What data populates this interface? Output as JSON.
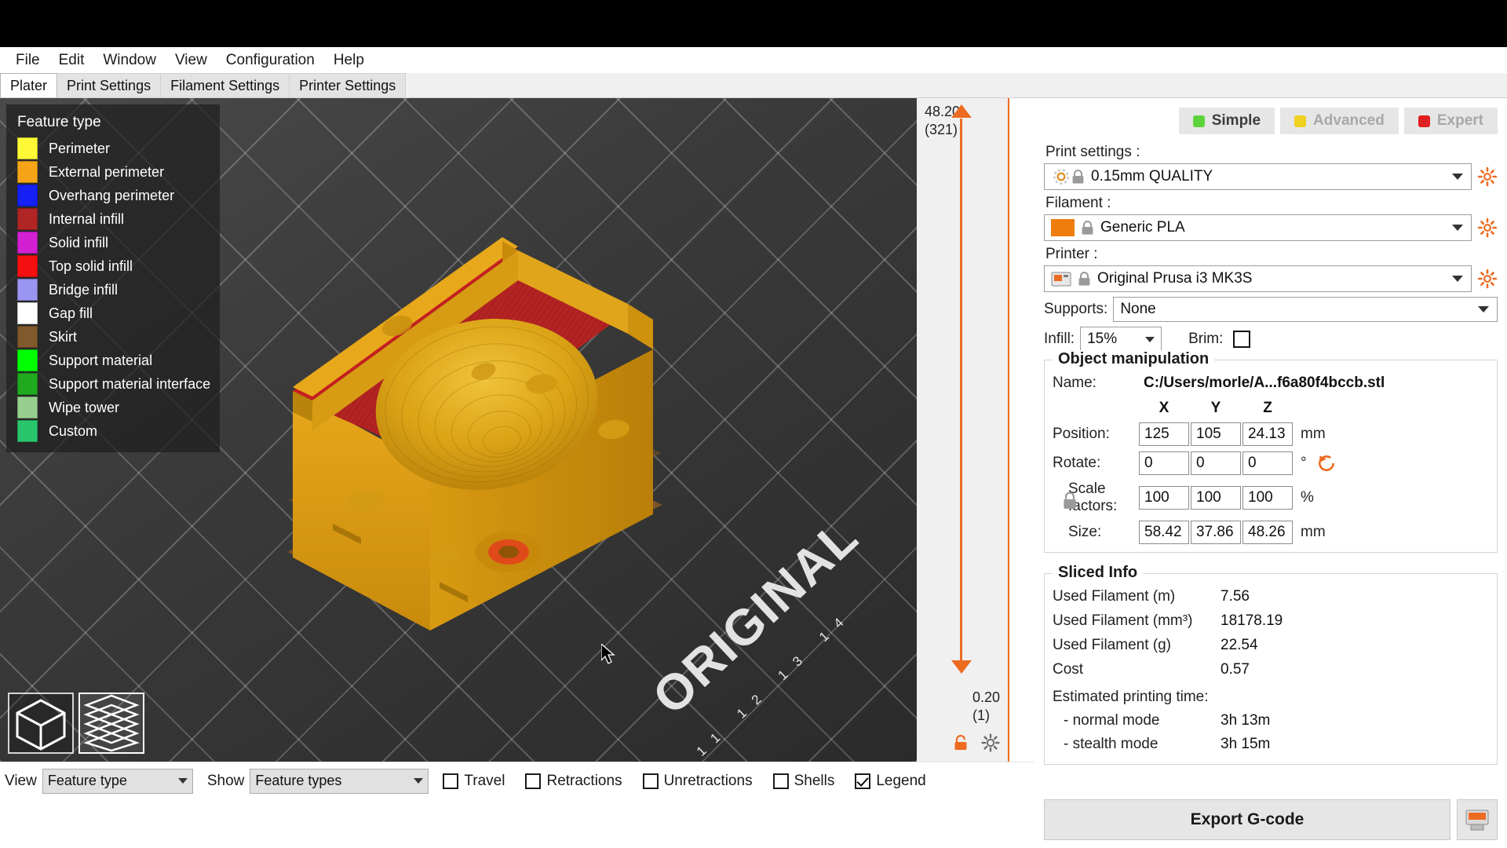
{
  "menu": {
    "items": [
      "File",
      "Edit",
      "Window",
      "View",
      "Configuration",
      "Help"
    ]
  },
  "tabs": [
    {
      "label": "Plater",
      "active": true
    },
    {
      "label": "Print Settings",
      "active": false
    },
    {
      "label": "Filament Settings",
      "active": false
    },
    {
      "label": "Printer Settings",
      "active": false
    }
  ],
  "legend": {
    "title": "Feature type",
    "items": [
      {
        "label": "Perimeter",
        "color": "#fdf936"
      },
      {
        "label": "External perimeter",
        "color": "#f5a417"
      },
      {
        "label": "Overhang perimeter",
        "color": "#1520f5"
      },
      {
        "label": "Internal infill",
        "color": "#b12525"
      },
      {
        "label": "Solid infill",
        "color": "#d220d2"
      },
      {
        "label": "Top solid infill",
        "color": "#f41010"
      },
      {
        "label": "Bridge infill",
        "color": "#9a95f0"
      },
      {
        "label": "Gap fill",
        "color": "#ffffff"
      },
      {
        "label": "Skirt",
        "color": "#80592c"
      },
      {
        "label": "Support material",
        "color": "#00ff00"
      },
      {
        "label": "Support material interface",
        "color": "#1faa1f"
      },
      {
        "label": "Wipe tower",
        "color": "#97cf8e"
      },
      {
        "label": "Custom",
        "color": "#29c66e"
      }
    ]
  },
  "viewport": {
    "bed_brand": "ORIGINAL",
    "bed_ruler": "11 12 13 14"
  },
  "layer_slider": {
    "top_value": "48.20",
    "top_layer": "(321)",
    "bottom_value": "0.20",
    "bottom_layer": "(1)"
  },
  "bottom_toolbar": {
    "view_label": "View",
    "view_value": "Feature type",
    "show_label": "Show",
    "show_value": "Feature types",
    "checkboxes": [
      {
        "label": "Travel",
        "checked": false
      },
      {
        "label": "Retractions",
        "checked": false
      },
      {
        "label": "Unretractions",
        "checked": false
      },
      {
        "label": "Shells",
        "checked": false
      },
      {
        "label": "Legend",
        "checked": true
      }
    ]
  },
  "right_panel": {
    "modes": [
      {
        "label": "Simple",
        "color": "#5ed23a",
        "active": true
      },
      {
        "label": "Advanced",
        "color": "#f0d020",
        "active": false
      },
      {
        "label": "Expert",
        "color": "#e02020",
        "active": false
      }
    ],
    "print_settings_label": "Print settings :",
    "print_settings_value": "0.15mm QUALITY",
    "filament_label": "Filament :",
    "filament_value": "Generic PLA",
    "filament_color": "#ef7d0e",
    "printer_label": "Printer :",
    "printer_value": "Original Prusa i3 MK3S",
    "supports_label": "Supports:",
    "supports_value": "None",
    "infill_label": "Infill:",
    "infill_value": "15%",
    "brim_label": "Brim:",
    "brim_checked": false,
    "object_manipulation": {
      "title": "Object manipulation",
      "name_label": "Name:",
      "name_value": "C:/Users/morle/A...f6a80f4bccb.stl",
      "axes": [
        "X",
        "Y",
        "Z"
      ],
      "rows": [
        {
          "label": "Position:",
          "values": [
            "125",
            "105",
            "24.13"
          ],
          "unit": "mm",
          "indent": false
        },
        {
          "label": "Rotate:",
          "values": [
            "0",
            "0",
            "0"
          ],
          "unit": "°",
          "indent": false
        },
        {
          "label": "Scale factors:",
          "values": [
            "100",
            "100",
            "100"
          ],
          "unit": "%",
          "indent": true
        },
        {
          "label": "Size:",
          "values": [
            "58.42",
            "37.86",
            "48.26"
          ],
          "unit": "mm",
          "indent": true
        }
      ]
    },
    "sliced_info": {
      "title": "Sliced Info",
      "rows": [
        {
          "key": "Used Filament (m)",
          "value": "7.56"
        },
        {
          "key": "Used Filament (mm³)",
          "value": "18178.19"
        },
        {
          "key": "Used Filament (g)",
          "value": "22.54"
        },
        {
          "key": "Cost",
          "value": "0.57"
        }
      ],
      "time_header": "Estimated printing time:",
      "times": [
        {
          "key": "- normal mode",
          "value": "3h 13m"
        },
        {
          "key": "- stealth mode",
          "value": "3h 15m"
        }
      ]
    },
    "export_label": "Export G-code"
  }
}
